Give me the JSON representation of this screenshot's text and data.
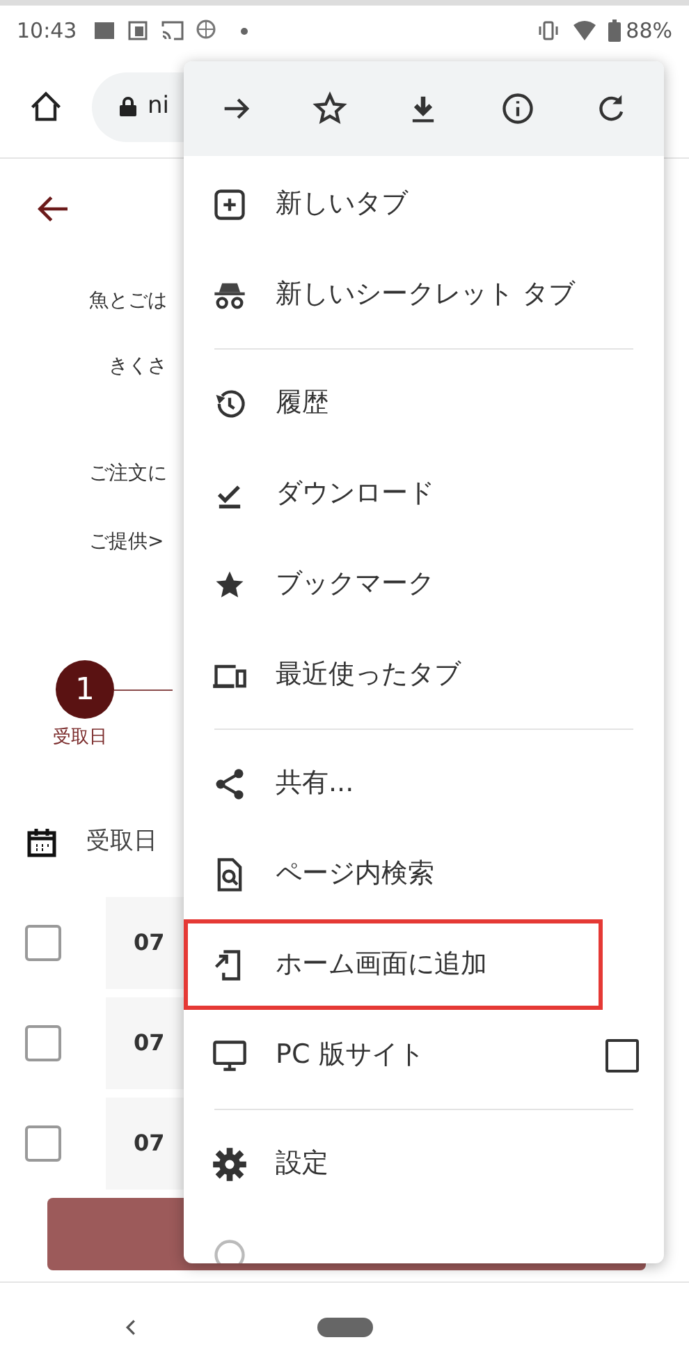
{
  "status_bar": {
    "time": "10:43",
    "battery": "88%"
  },
  "toolbar": {
    "url": "ni"
  },
  "page": {
    "lines": [
      "魚とごは",
      "きくさ",
      "ご注文に",
      "ご提供>"
    ],
    "stepper": {
      "number": "1",
      "label": "受取日"
    },
    "date_header": "受取日",
    "rows": [
      {
        "date": "07",
        "checked": false
      },
      {
        "date": "07",
        "checked": false
      },
      {
        "date": "07",
        "checked": false
      }
    ]
  },
  "menu": {
    "top_icons": [
      {
        "kind": "forward"
      },
      {
        "kind": "star"
      },
      {
        "kind": "download"
      },
      {
        "kind": "info"
      },
      {
        "kind": "reload"
      }
    ],
    "items": [
      {
        "kind": "newtab",
        "label": "新しいタブ"
      },
      {
        "kind": "incognito",
        "label": "新しいシークレット タブ",
        "divider_after": true
      },
      {
        "kind": "history",
        "label": "履歴"
      },
      {
        "kind": "downloads",
        "label": "ダウンロード"
      },
      {
        "kind": "bookmarks",
        "label": "ブックマーク"
      },
      {
        "kind": "recent",
        "label": "最近使ったタブ",
        "divider_after": true
      },
      {
        "kind": "share",
        "label": "共有..."
      },
      {
        "kind": "find",
        "label": "ページ内検索"
      },
      {
        "kind": "addhome",
        "label": "ホーム画面に追加",
        "highlighted": true
      },
      {
        "kind": "desktop",
        "label": "PC 版サイト",
        "checked": false,
        "divider_after": true
      },
      {
        "kind": "settings",
        "label": "設定"
      },
      {
        "kind": "help"
      }
    ]
  }
}
